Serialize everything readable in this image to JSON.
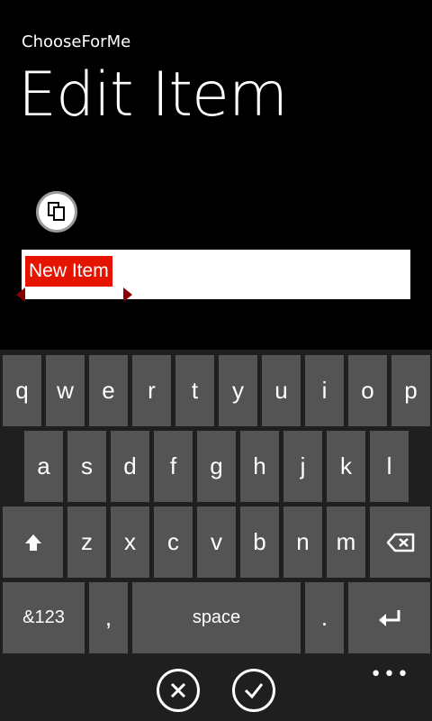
{
  "header": {
    "app_title": "ChooseForMe",
    "page_title": "Edit Item"
  },
  "editor": {
    "text": "New Item",
    "copy_icon": "copy-icon"
  },
  "keyboard": {
    "row1": [
      "q",
      "w",
      "e",
      "r",
      "t",
      "y",
      "u",
      "i",
      "o",
      "p"
    ],
    "row2": [
      "a",
      "s",
      "d",
      "f",
      "g",
      "h",
      "j",
      "k",
      "l"
    ],
    "row3": [
      "z",
      "x",
      "c",
      "v",
      "b",
      "n",
      "m"
    ],
    "shift_icon": "shift-icon",
    "backspace_icon": "backspace-icon",
    "symbols_label": "&123",
    "comma_label": ",",
    "space_label": "space",
    "period_label": ".",
    "enter_icon": "enter-icon"
  },
  "appbar": {
    "cancel_icon": "cancel-icon",
    "confirm_icon": "checkmark-icon",
    "more_label": "•••"
  },
  "colors": {
    "accent": "#e51400",
    "key": "#545454",
    "keyboard_bg": "#1f1f1f"
  }
}
